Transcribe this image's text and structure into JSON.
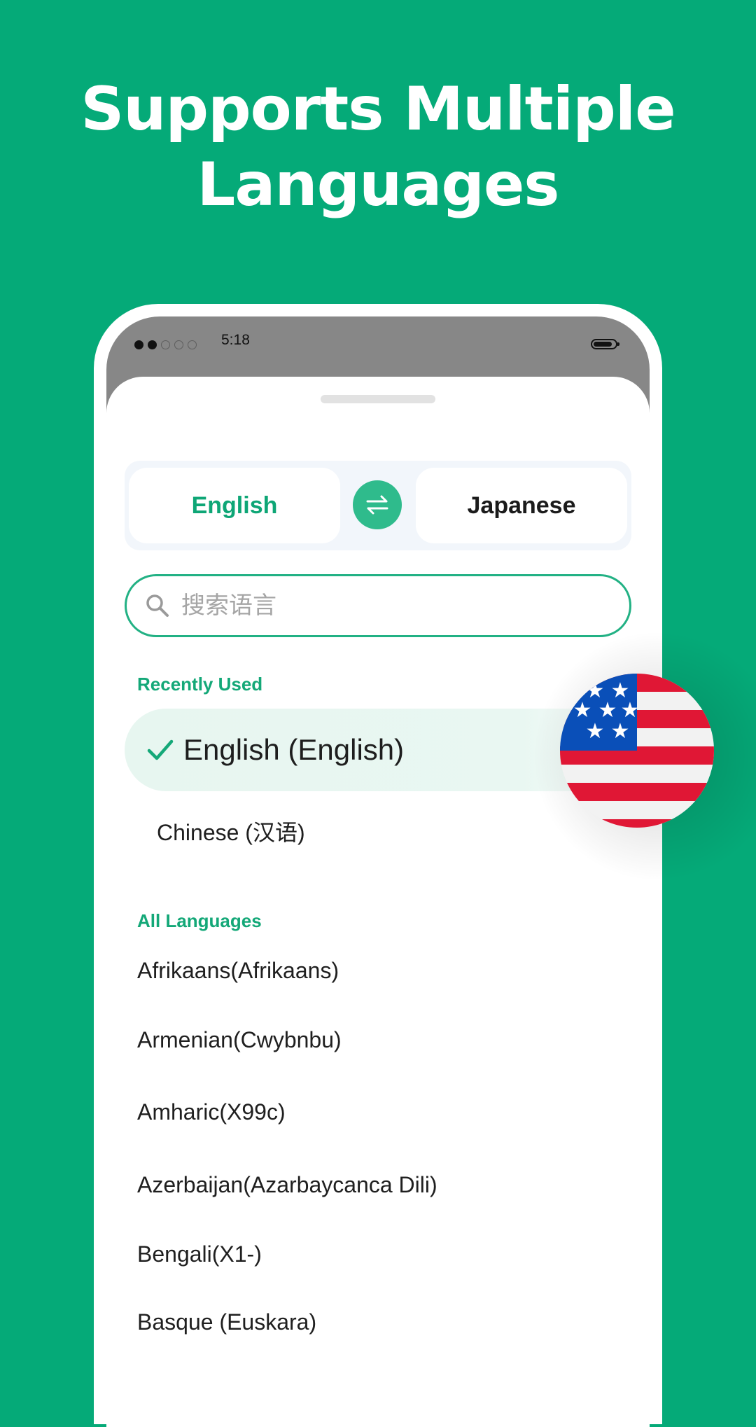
{
  "headline": {
    "line1": "Supports Multiple",
    "line2": "Languages"
  },
  "statusbar": {
    "time": "5:18"
  },
  "language_bar": {
    "source": "English",
    "target": "Japanese"
  },
  "search": {
    "placeholder": "搜索语言"
  },
  "recent": {
    "title": "Recently Used",
    "selected": "English (English)",
    "items": [
      "Chinese (汉语)"
    ]
  },
  "all": {
    "title": "All Languages",
    "items": [
      "Afrikaans(Afrikaans)",
      "Armenian(Cwybnbu)",
      "Amharic(X99c)",
      "Azerbaijan(Azarbaycanca Dili)",
      "Bengali(X1-)",
      "Basque (Euskara)"
    ]
  },
  "colors": {
    "background": "#05aa78",
    "accent": "#14a878",
    "swap": "#2fbb8c"
  },
  "icons": [
    "swap-icon",
    "search-icon",
    "check-icon",
    "us-flag-icon"
  ]
}
